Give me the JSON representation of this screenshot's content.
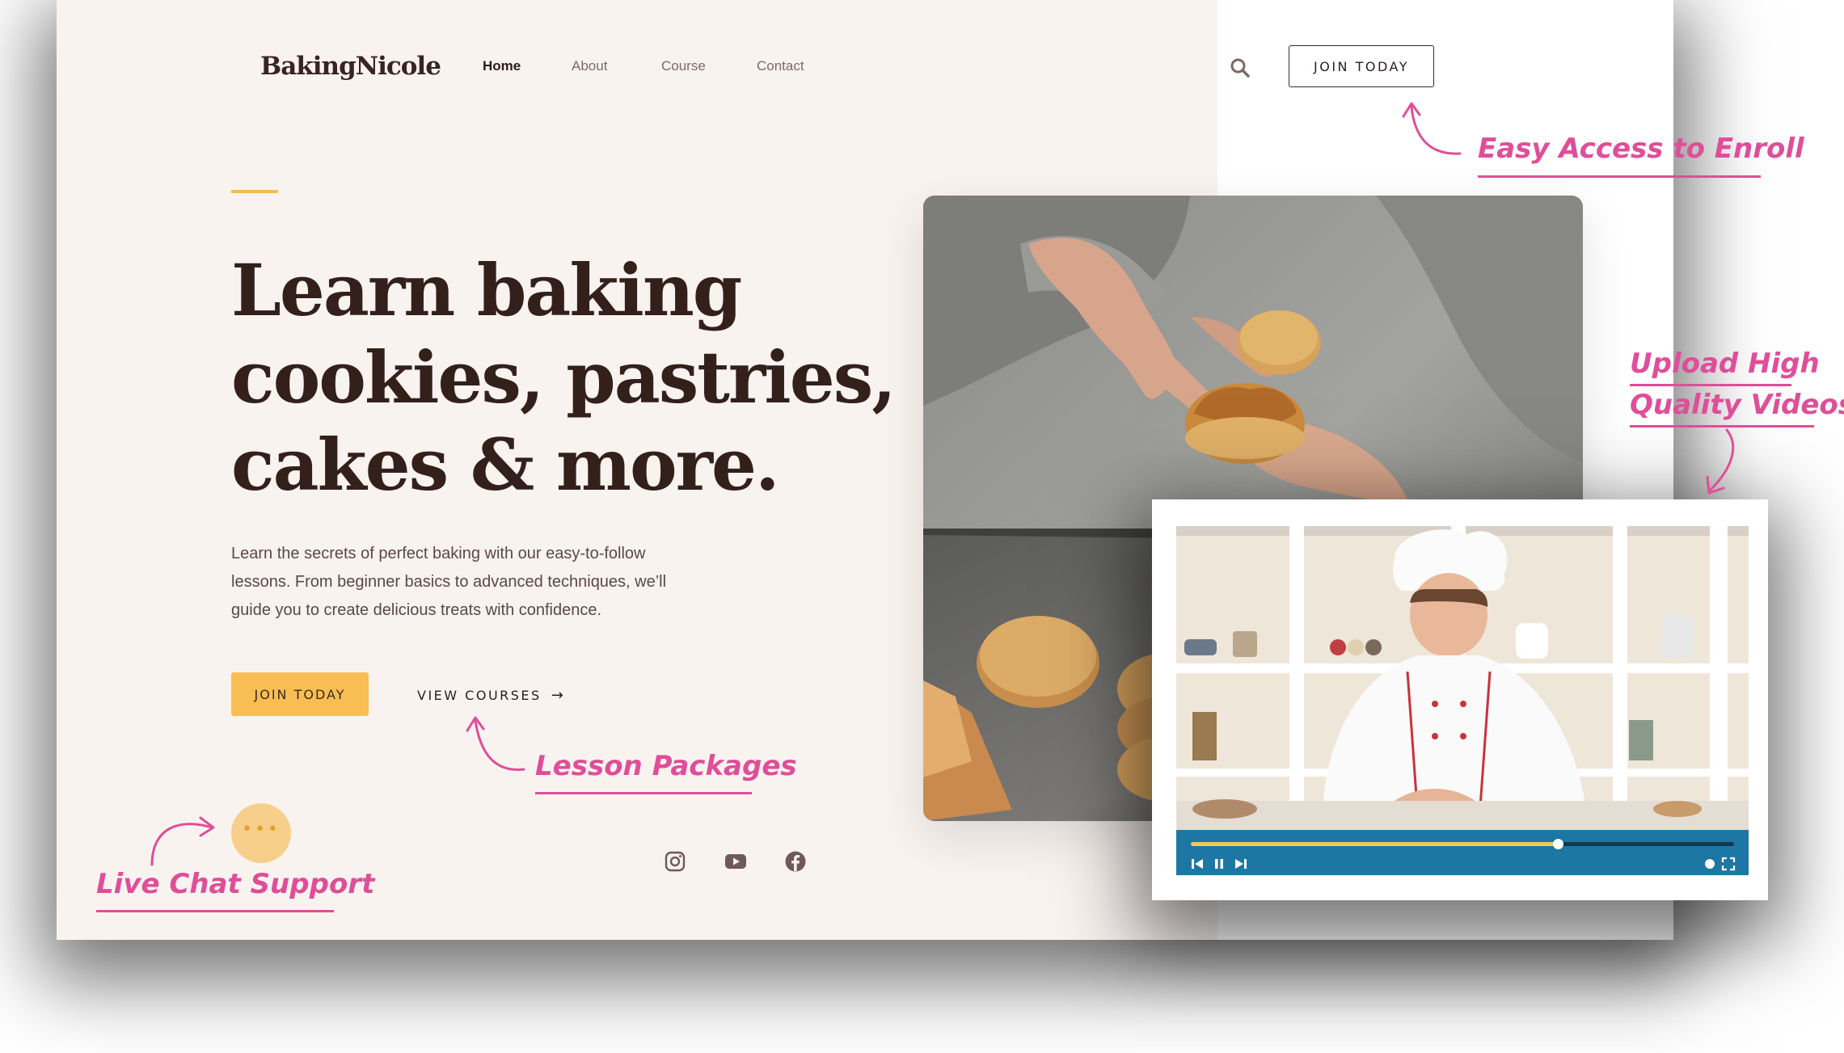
{
  "header": {
    "logo": "BakingNicole",
    "nav": [
      {
        "label": "Home",
        "active": true
      },
      {
        "label": "About",
        "active": false
      },
      {
        "label": "Course",
        "active": false
      },
      {
        "label": "Contact",
        "active": false
      }
    ],
    "search_icon": "search-icon",
    "join_button": "JOIN TODAY"
  },
  "hero": {
    "headline_lines": [
      "Learn baking",
      "cookies, pastries,",
      "cakes & more."
    ],
    "body_lines": [
      "Learn the secrets of perfect baking with our easy-to-follow",
      "lessons. From beginner basics to advanced techniques, we’ll",
      "guide you to create delicious treats with confidence."
    ],
    "primary_button": "JOIN TODAY",
    "secondary_button": "VIEW COURSES",
    "secondary_arrow": "→"
  },
  "social": [
    "instagram-icon",
    "youtube-icon",
    "facebook-icon"
  ],
  "chat": {
    "icon": "chat-bubble-icon",
    "dots": "•••"
  },
  "video": {
    "progress": 0.675,
    "controls": [
      "skip-back-icon",
      "pause-icon",
      "skip-forward-icon",
      "volume-dot-icon",
      "fullscreen-icon"
    ]
  },
  "annotations": {
    "enroll": "Easy Access to Enroll",
    "upload_line1": "Upload High",
    "upload_line2": "Quality Videos",
    "lesson": "Lesson Packages",
    "chat": "Live Chat Support"
  },
  "colors": {
    "page_bg": "#f9f3f0",
    "accent_yellow": "#f8be53",
    "annotation_pink": "#df4e98",
    "video_bar": "#1d77a4",
    "heading": "#33201b"
  }
}
